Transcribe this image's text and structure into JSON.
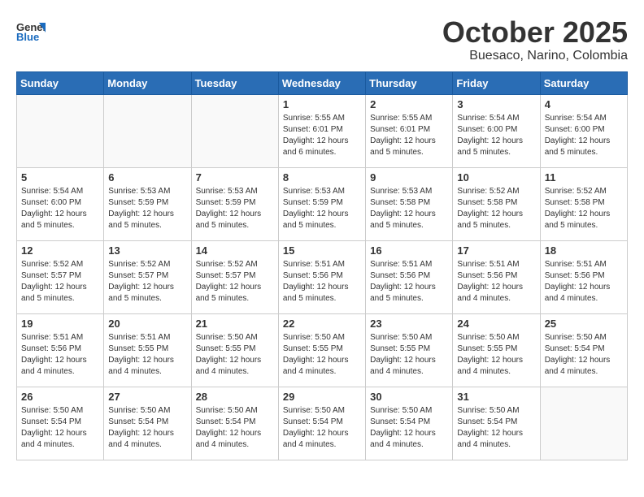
{
  "header": {
    "logo_general": "General",
    "logo_blue": "Blue",
    "month_title": "October 2025",
    "location": "Buesaco, Narino, Colombia"
  },
  "weekdays": [
    "Sunday",
    "Monday",
    "Tuesday",
    "Wednesday",
    "Thursday",
    "Friday",
    "Saturday"
  ],
  "weeks": [
    [
      {
        "day": "",
        "info": ""
      },
      {
        "day": "",
        "info": ""
      },
      {
        "day": "",
        "info": ""
      },
      {
        "day": "1",
        "info": "Sunrise: 5:55 AM\nSunset: 6:01 PM\nDaylight: 12 hours\nand 6 minutes."
      },
      {
        "day": "2",
        "info": "Sunrise: 5:55 AM\nSunset: 6:01 PM\nDaylight: 12 hours\nand 5 minutes."
      },
      {
        "day": "3",
        "info": "Sunrise: 5:54 AM\nSunset: 6:00 PM\nDaylight: 12 hours\nand 5 minutes."
      },
      {
        "day": "4",
        "info": "Sunrise: 5:54 AM\nSunset: 6:00 PM\nDaylight: 12 hours\nand 5 minutes."
      }
    ],
    [
      {
        "day": "5",
        "info": "Sunrise: 5:54 AM\nSunset: 6:00 PM\nDaylight: 12 hours\nand 5 minutes."
      },
      {
        "day": "6",
        "info": "Sunrise: 5:53 AM\nSunset: 5:59 PM\nDaylight: 12 hours\nand 5 minutes."
      },
      {
        "day": "7",
        "info": "Sunrise: 5:53 AM\nSunset: 5:59 PM\nDaylight: 12 hours\nand 5 minutes."
      },
      {
        "day": "8",
        "info": "Sunrise: 5:53 AM\nSunset: 5:59 PM\nDaylight: 12 hours\nand 5 minutes."
      },
      {
        "day": "9",
        "info": "Sunrise: 5:53 AM\nSunset: 5:58 PM\nDaylight: 12 hours\nand 5 minutes."
      },
      {
        "day": "10",
        "info": "Sunrise: 5:52 AM\nSunset: 5:58 PM\nDaylight: 12 hours\nand 5 minutes."
      },
      {
        "day": "11",
        "info": "Sunrise: 5:52 AM\nSunset: 5:58 PM\nDaylight: 12 hours\nand 5 minutes."
      }
    ],
    [
      {
        "day": "12",
        "info": "Sunrise: 5:52 AM\nSunset: 5:57 PM\nDaylight: 12 hours\nand 5 minutes."
      },
      {
        "day": "13",
        "info": "Sunrise: 5:52 AM\nSunset: 5:57 PM\nDaylight: 12 hours\nand 5 minutes."
      },
      {
        "day": "14",
        "info": "Sunrise: 5:52 AM\nSunset: 5:57 PM\nDaylight: 12 hours\nand 5 minutes."
      },
      {
        "day": "15",
        "info": "Sunrise: 5:51 AM\nSunset: 5:56 PM\nDaylight: 12 hours\nand 5 minutes."
      },
      {
        "day": "16",
        "info": "Sunrise: 5:51 AM\nSunset: 5:56 PM\nDaylight: 12 hours\nand 5 minutes."
      },
      {
        "day": "17",
        "info": "Sunrise: 5:51 AM\nSunset: 5:56 PM\nDaylight: 12 hours\nand 4 minutes."
      },
      {
        "day": "18",
        "info": "Sunrise: 5:51 AM\nSunset: 5:56 PM\nDaylight: 12 hours\nand 4 minutes."
      }
    ],
    [
      {
        "day": "19",
        "info": "Sunrise: 5:51 AM\nSunset: 5:56 PM\nDaylight: 12 hours\nand 4 minutes."
      },
      {
        "day": "20",
        "info": "Sunrise: 5:51 AM\nSunset: 5:55 PM\nDaylight: 12 hours\nand 4 minutes."
      },
      {
        "day": "21",
        "info": "Sunrise: 5:50 AM\nSunset: 5:55 PM\nDaylight: 12 hours\nand 4 minutes."
      },
      {
        "day": "22",
        "info": "Sunrise: 5:50 AM\nSunset: 5:55 PM\nDaylight: 12 hours\nand 4 minutes."
      },
      {
        "day": "23",
        "info": "Sunrise: 5:50 AM\nSunset: 5:55 PM\nDaylight: 12 hours\nand 4 minutes."
      },
      {
        "day": "24",
        "info": "Sunrise: 5:50 AM\nSunset: 5:55 PM\nDaylight: 12 hours\nand 4 minutes."
      },
      {
        "day": "25",
        "info": "Sunrise: 5:50 AM\nSunset: 5:54 PM\nDaylight: 12 hours\nand 4 minutes."
      }
    ],
    [
      {
        "day": "26",
        "info": "Sunrise: 5:50 AM\nSunset: 5:54 PM\nDaylight: 12 hours\nand 4 minutes."
      },
      {
        "day": "27",
        "info": "Sunrise: 5:50 AM\nSunset: 5:54 PM\nDaylight: 12 hours\nand 4 minutes."
      },
      {
        "day": "28",
        "info": "Sunrise: 5:50 AM\nSunset: 5:54 PM\nDaylight: 12 hours\nand 4 minutes."
      },
      {
        "day": "29",
        "info": "Sunrise: 5:50 AM\nSunset: 5:54 PM\nDaylight: 12 hours\nand 4 minutes."
      },
      {
        "day": "30",
        "info": "Sunrise: 5:50 AM\nSunset: 5:54 PM\nDaylight: 12 hours\nand 4 minutes."
      },
      {
        "day": "31",
        "info": "Sunrise: 5:50 AM\nSunset: 5:54 PM\nDaylight: 12 hours\nand 4 minutes."
      },
      {
        "day": "",
        "info": ""
      }
    ]
  ]
}
